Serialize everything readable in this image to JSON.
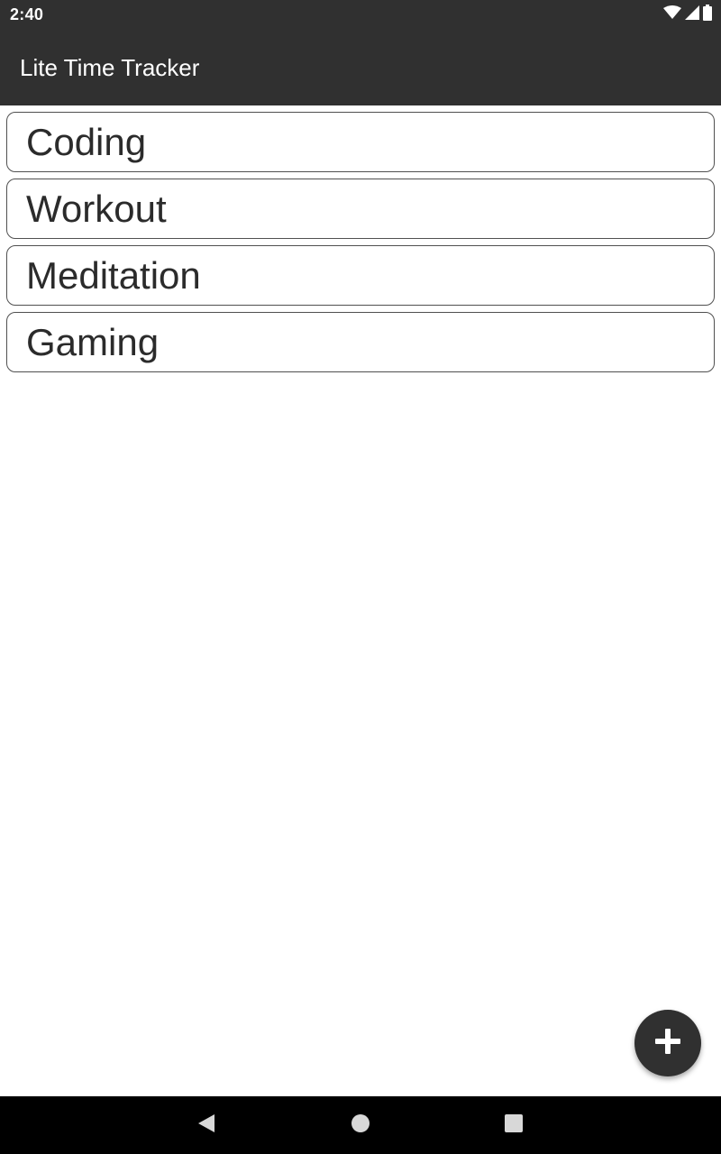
{
  "status_bar": {
    "time": "2:40",
    "icons": [
      "wifi-icon",
      "cellular-signal-icon",
      "battery-icon"
    ]
  },
  "app_bar": {
    "title": "Lite Time Tracker"
  },
  "activities": [
    {
      "label": "Coding"
    },
    {
      "label": "Workout"
    },
    {
      "label": "Meditation"
    },
    {
      "label": "Gaming"
    }
  ],
  "fab": {
    "icon": "plus-icon"
  },
  "nav_bar": {
    "icons": [
      "back-icon",
      "home-icon",
      "recents-icon"
    ]
  },
  "colors": {
    "bar_background": "#303030",
    "nav_background": "#000000",
    "item_border": "#505050",
    "item_text": "#2b2b2b"
  }
}
